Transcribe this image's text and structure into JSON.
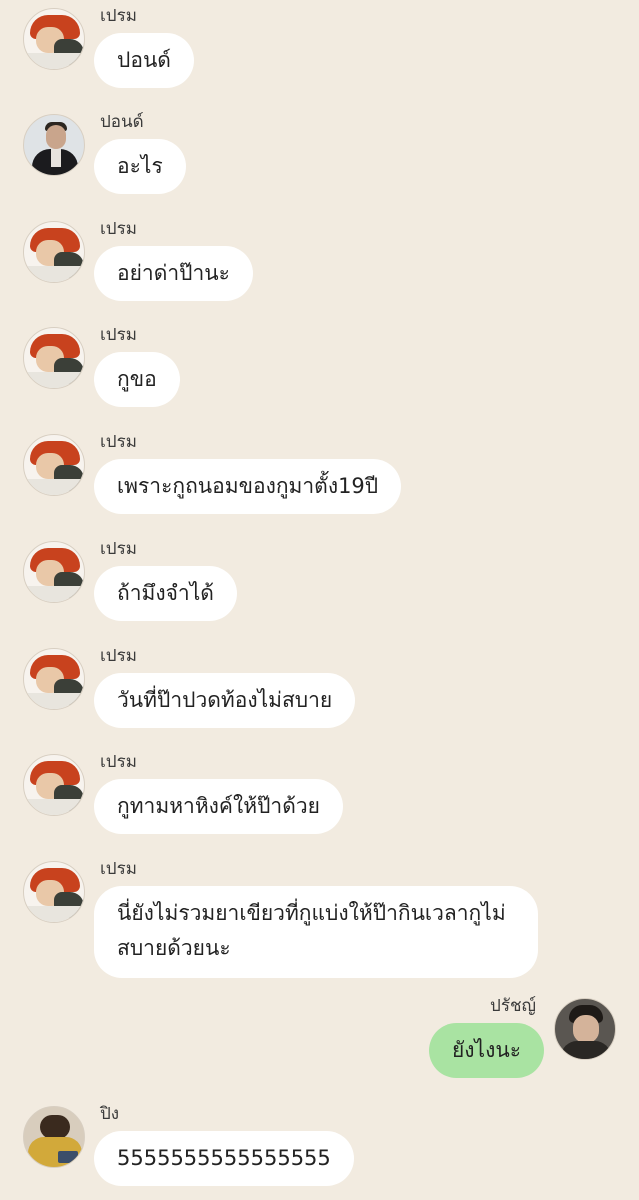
{
  "colors": {
    "background": "#f2ebe0",
    "incoming_bubble": "#ffffff",
    "outgoing_bubble": "#a9e3a2"
  },
  "avatars": {
    "prem": "prem-avatar-photo",
    "pond": "pond-avatar-photo",
    "prach": "prach-avatar-photo",
    "ping": "ping-avatar-photo"
  },
  "messages": [
    {
      "sender": "เปรม",
      "text": "ปอนด์",
      "side": "left",
      "avatar": "prem"
    },
    {
      "sender": "ปอนด์",
      "text": "อะไร",
      "side": "left",
      "avatar": "pond"
    },
    {
      "sender": "เปรม",
      "text": "อย่าด่าป๊านะ",
      "side": "left",
      "avatar": "prem"
    },
    {
      "sender": "เปรม",
      "text": "กูขอ",
      "side": "left",
      "avatar": "prem"
    },
    {
      "sender": "เปรม",
      "text": "เพราะกูถนอมของกูมาตั้ง19ปี",
      "side": "left",
      "avatar": "prem"
    },
    {
      "sender": "เปรม",
      "text": "ถ้ามึงจำได้",
      "side": "left",
      "avatar": "prem"
    },
    {
      "sender": "เปรม",
      "text": "วันที่ป๊าปวดท้องไม่สบาย",
      "side": "left",
      "avatar": "prem"
    },
    {
      "sender": "เปรม",
      "text": "กูทามหาหิงค์ให้ป๊าด้วย",
      "side": "left",
      "avatar": "prem"
    },
    {
      "sender": "เปรม",
      "text": "นี่ยังไม่รวมยาเขียวที่กูแบ่งให้ป๊ากินเวลากูไม่สบายด้วยนะ",
      "side": "left",
      "avatar": "prem"
    },
    {
      "sender": "ปรัชญ์",
      "text": "ยังไงนะ",
      "side": "right",
      "avatar": "prach"
    },
    {
      "sender": "ปิง",
      "text": "5555555555555555",
      "side": "left",
      "avatar": "ping"
    }
  ]
}
